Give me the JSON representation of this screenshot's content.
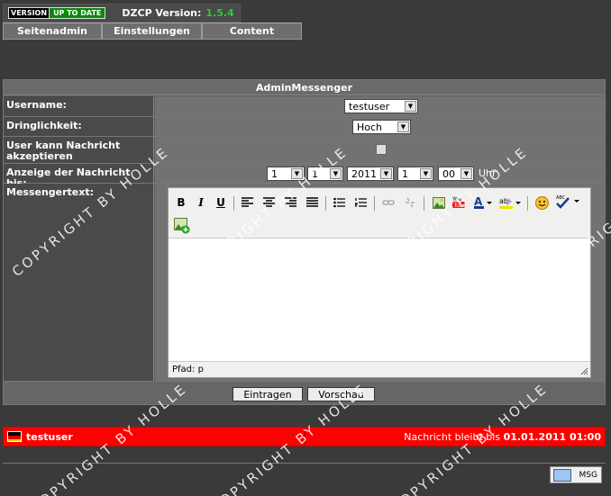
{
  "topbar": {
    "badge_left": "VERSION",
    "badge_right": "UP TO DATE",
    "label": "DZCP Version:",
    "version": "1.5.4"
  },
  "nav": [
    "Seitenadmin",
    "Einstellungen",
    "Content"
  ],
  "form": {
    "title": "AdminMessenger",
    "username_label": "Username:",
    "username_value": "testuser",
    "priority_label": "Dringlichkeit:",
    "priority_value": "Hoch",
    "accept_label": "User kann Nachricht akzeptieren",
    "display_label": "Anzeige der Nachricht bis:",
    "date_day": "1",
    "date_month": "1",
    "date_year": "2011",
    "time_hour": "1",
    "time_min": "00",
    "uhr": "Uhr",
    "text_label": "Messengertext:",
    "editor_path": "Pfad: p",
    "submit_label": "Eintragen",
    "preview_label": "Vorschau"
  },
  "messenger": {
    "user": "testuser",
    "info_prefix": "Nachricht bleibt bis",
    "info_date": "01.01.2011 01:00",
    "msg_button": "MSG"
  },
  "watermark": "COPYRIGHT BY HOLLE",
  "colors": {
    "bar": "#ff0000",
    "version": "#2ecc2e",
    "badge_green": "#0a8a0a"
  }
}
